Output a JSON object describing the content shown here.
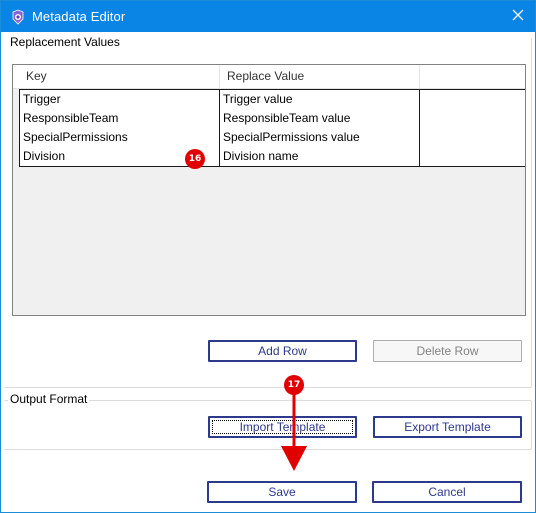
{
  "window": {
    "title": "Metadata Editor",
    "accent_color": "#0a84e5"
  },
  "replacement_group": {
    "label": "Replacement Values",
    "columns": [
      "Key",
      "Replace Value",
      ""
    ],
    "rows": [
      {
        "key": "Trigger",
        "value": "Trigger value"
      },
      {
        "key": "ResponsibleTeam",
        "value": "ResponsibleTeam value"
      },
      {
        "key": "SpecialPermissions",
        "value": "SpecialPermissions value"
      },
      {
        "key": "Division",
        "value": "Division name"
      }
    ],
    "add_row_label": "Add Row",
    "delete_row_label": "Delete Row"
  },
  "output_group": {
    "label": "Output Format",
    "import_label": "Import Template",
    "export_label": "Export Template"
  },
  "footer": {
    "save_label": "Save",
    "cancel_label": "Cancel"
  },
  "annotations": {
    "step_a": "16",
    "step_b": "17",
    "color": "#e00000"
  }
}
